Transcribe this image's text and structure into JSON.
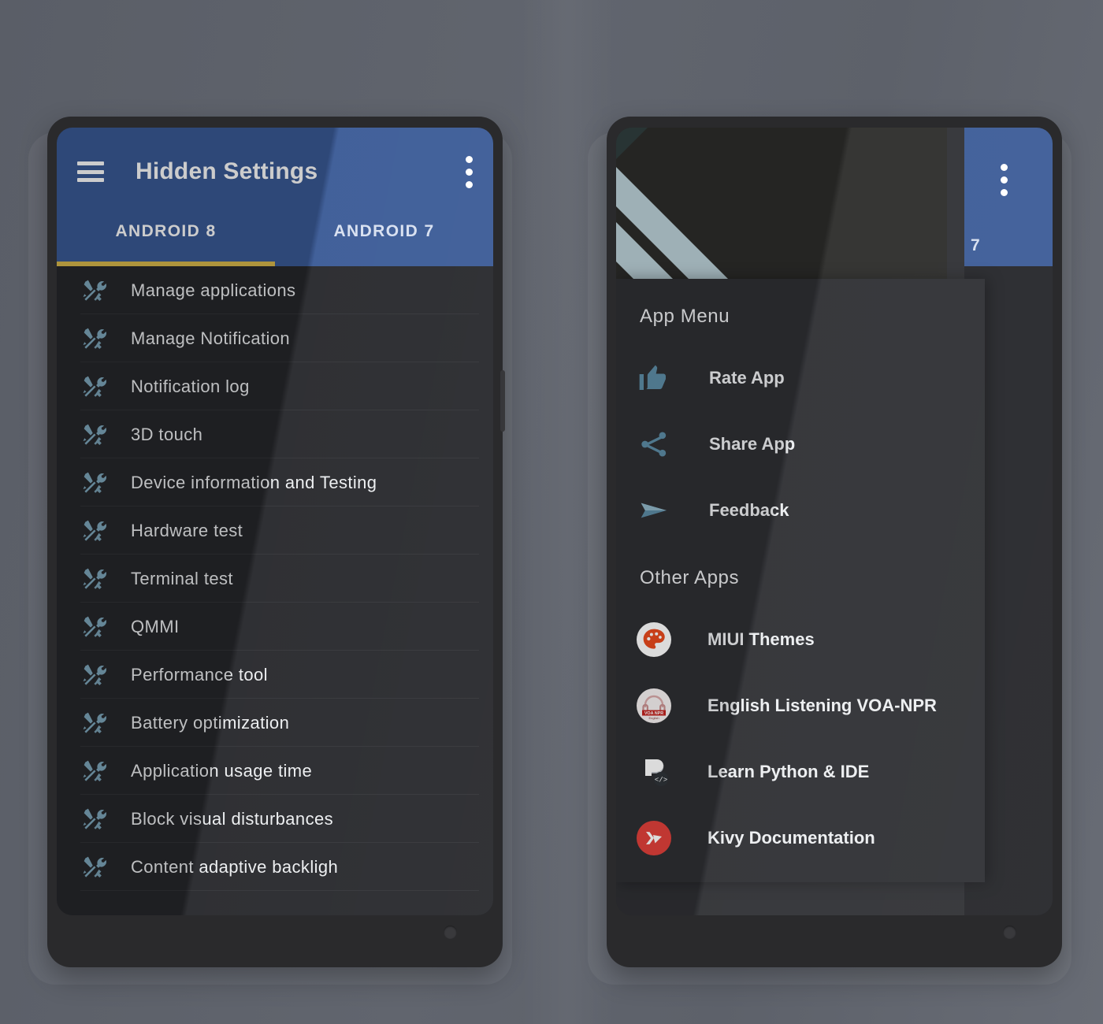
{
  "colors": {
    "background": "#5e626b",
    "appbar_blue": "#3a5a96",
    "tab_indicator_yellow": "#d9b94b",
    "tool_icon_blue": "#7ea8bd",
    "drawer_icon_blue": "#5c8ba4",
    "screen_dark": "#26272b",
    "drawer_dark": "#2d2e32",
    "text_primary": "#eceef0",
    "bezel": "#2a2a2c",
    "miui_orange": "#e8491d",
    "kivy_red": "#e0403a",
    "voa_red": "#c2231f",
    "stripe_light": "#b8cdd4",
    "stripe_dark": "#2f4440"
  },
  "left_phone": {
    "name": "Hidden Settings app screen",
    "appbar": {
      "menu_icon": "hamburger-icon",
      "title": "Hidden Settings",
      "overflow_icon": "kebab-menu-icon"
    },
    "tabs": [
      {
        "label": "ANDROID 8",
        "active": true
      },
      {
        "label": "ANDROID 7",
        "active": false
      }
    ],
    "list_icon": "tools-screwdriver-wrench-icon",
    "items": [
      {
        "label": "Manage applications"
      },
      {
        "label": "Manage Notification"
      },
      {
        "label": "Notification log"
      },
      {
        "label": "3D touch"
      },
      {
        "label": "Device information and Testing"
      },
      {
        "label": "Hardware test"
      },
      {
        "label": "Terminal test"
      },
      {
        "label": "QMMI"
      },
      {
        "label": "Performance tool"
      },
      {
        "label": "Battery optimization"
      },
      {
        "label": "Application usage time"
      },
      {
        "label": "Block visual disturbances"
      },
      {
        "label": "Content adaptive backligh"
      }
    ]
  },
  "right_phone": {
    "name": "Hidden Settings navigation drawer open",
    "appbar": {
      "overflow_icon": "kebab-menu-icon",
      "tab_remnant": "7"
    },
    "drawer": {
      "app_menu": {
        "title": "App Menu",
        "items": [
          {
            "label": "Rate App",
            "icon": "thumbs-up-icon"
          },
          {
            "label": "Share App",
            "icon": "share-icon"
          },
          {
            "label": "Feedback",
            "icon": "send-paper-plane-icon"
          }
        ]
      },
      "other_apps": {
        "title": "Other Apps",
        "items": [
          {
            "label": "MIUI Themes",
            "icon": "miui-themes-palette-icon"
          },
          {
            "label": "English Listening VOA-NPR",
            "icon": "voa-npr-headphones-icon"
          },
          {
            "label": "Learn Python & IDE",
            "icon": "learn-python-ide-icon"
          },
          {
            "label": "Kivy Documentation",
            "icon": "kivy-logo-icon"
          }
        ]
      }
    }
  }
}
